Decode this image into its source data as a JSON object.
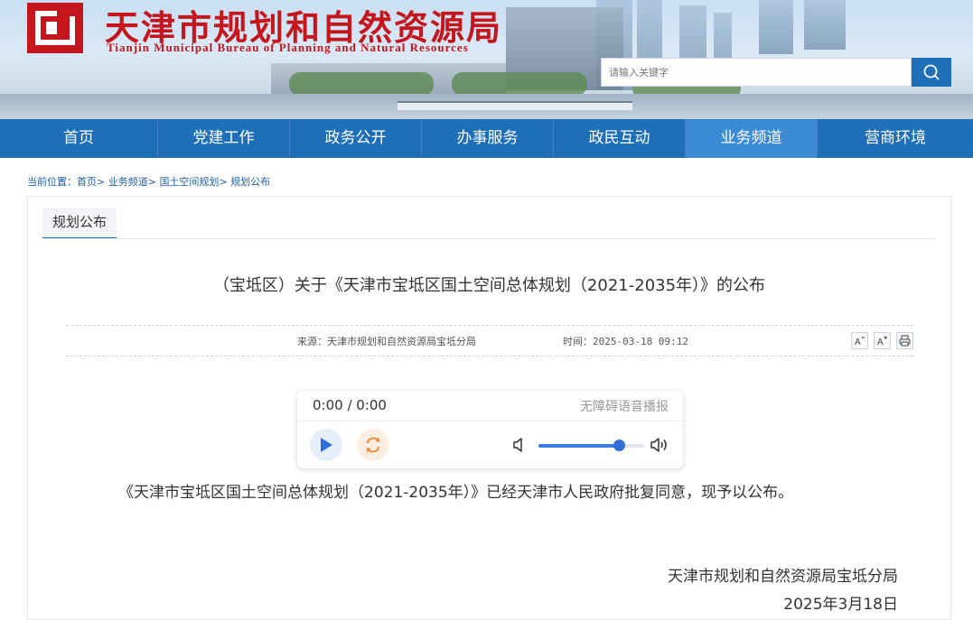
{
  "header": {
    "title": "天津市规划和自然资源局",
    "subtitle": "Tianjin Municipal Bureau of Planning and Natural Resources",
    "search": {
      "placeholder": "请输入关键字",
      "button_icon": "search-icon"
    },
    "brand_color": "#c4161c"
  },
  "nav": {
    "items": [
      {
        "label": "首页"
      },
      {
        "label": "党建工作"
      },
      {
        "label": "政务公开"
      },
      {
        "label": "办事服务"
      },
      {
        "label": "政民互动"
      },
      {
        "label": "业务频道"
      },
      {
        "label": "营商环境"
      }
    ],
    "active_index": 5,
    "color": "#1f6fb8",
    "active_color": "#3b8ad6"
  },
  "breadcrumb": {
    "prefix": "当前位置：",
    "items": [
      "首页",
      "业务频道",
      "国土空间规划",
      "规划公布"
    ],
    "separator": ">"
  },
  "panel": {
    "tab_label": "规划公布"
  },
  "article": {
    "title": "（宝坻区）关于《天津市宝坻区国土空间总体规划（2021-2035年）》的公布",
    "source": "来源：天津市规划和自然资源局宝坻分局",
    "time": "时间：2025-03-18 09:12",
    "tools": {
      "decrease_font": "A-",
      "increase_font": "A+",
      "print": "print-icon"
    },
    "body": "《天津市宝坻区国土空间总体规划（2021-2035年）》已经天津市人民政府批复同意，现予以公布。",
    "signature_org": "天津市规划和自然资源局宝坻分局",
    "signature_date": "2025年3月18日"
  },
  "player": {
    "time": "0:00 / 0:00",
    "label": "无障碍语音播报",
    "volume": 0.76,
    "icons": [
      "play-icon",
      "replay-icon",
      "volume-low-icon",
      "volume-high-icon"
    ]
  }
}
